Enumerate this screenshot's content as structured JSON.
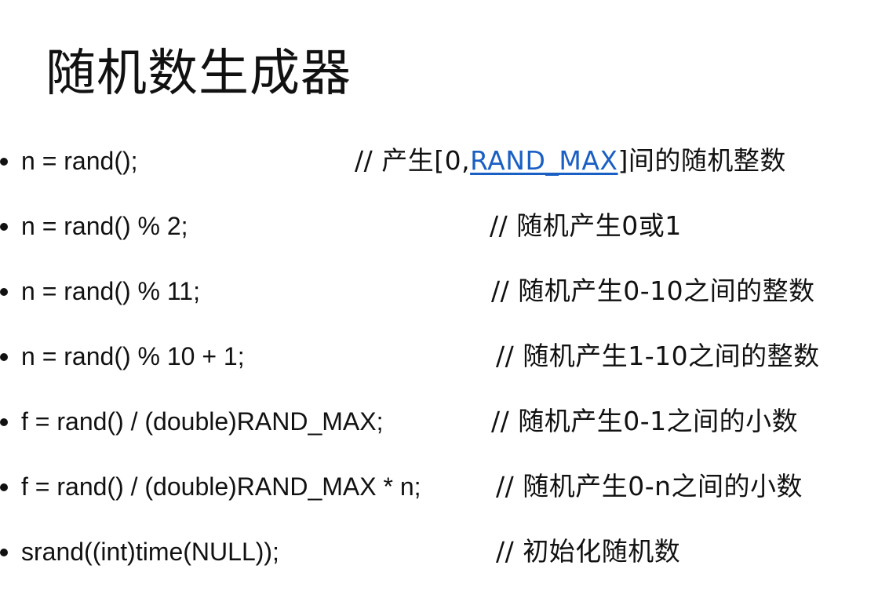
{
  "title": "随机数生成器",
  "link_color": "#1a5fc4",
  "rows": [
    {
      "code": "n = rand();",
      "comment_prefix": "// 产生[0,",
      "comment_link": "RAND_MAX",
      "comment_suffix": "]间的随机整数"
    },
    {
      "code": "n = rand() % 2;",
      "comment": "// 随机产生0或1"
    },
    {
      "code": "n = rand() % 11;",
      "comment": "// 随机产生0-10之间的整数"
    },
    {
      "code": "n = rand() % 10 + 1;",
      "comment": "// 随机产生1-10之间的整数"
    },
    {
      "code": "f = rand() / (double)RAND_MAX;",
      "comment": "// 随机产生0-1之间的小数"
    },
    {
      "code": "f = rand() / (double)RAND_MAX * n;",
      "comment": "// 随机产生0-n之间的小数"
    },
    {
      "code": "srand((int)time(NULL));",
      "comment": "// 初始化随机数"
    }
  ]
}
